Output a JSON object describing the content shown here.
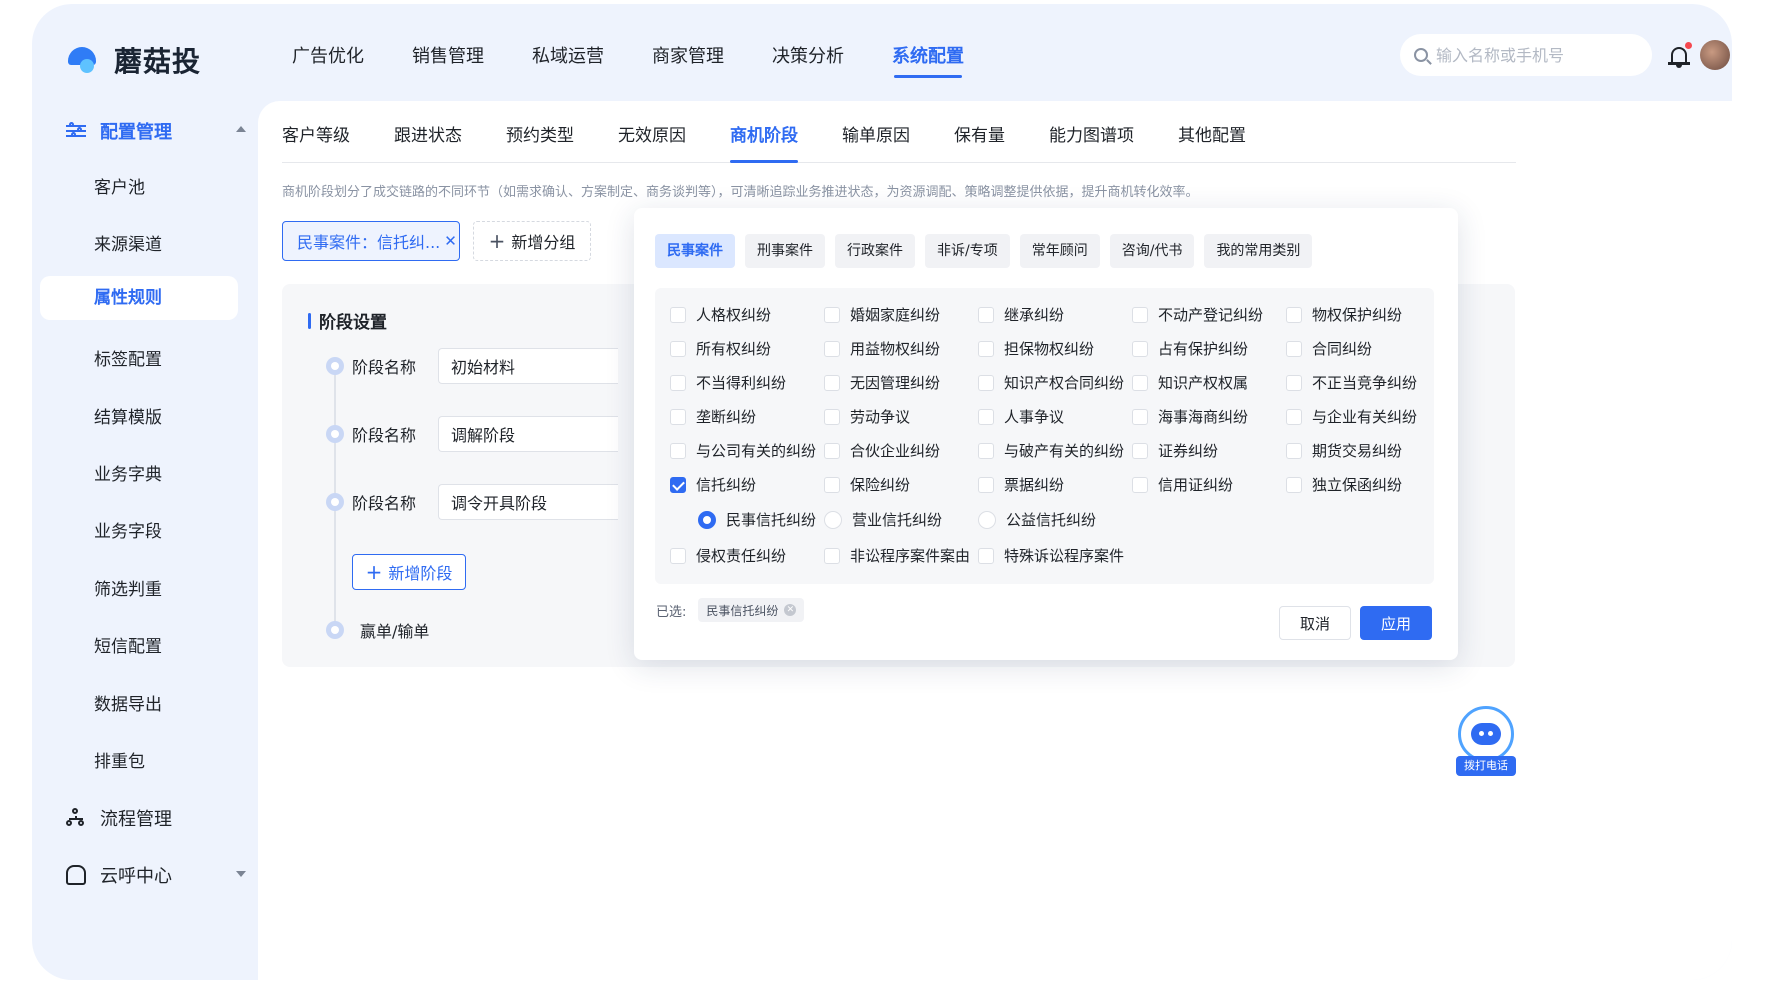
{
  "app": {
    "name": "蘑菇投"
  },
  "nav": {
    "items": [
      "广告优化",
      "销售管理",
      "私域运营",
      "商家管理",
      "决策分析",
      "系统配置"
    ],
    "active_index": 5
  },
  "search": {
    "placeholder": "输入名称或手机号",
    "value": ""
  },
  "sidebar": {
    "group_config": "配置管理",
    "items": [
      "客户池",
      "来源渠道",
      "属性规则",
      "标签配置",
      "结算模版",
      "业务字典",
      "业务字段",
      "筛选判重",
      "短信配置",
      "数据导出",
      "排重包"
    ],
    "active_index": 2,
    "group_flow": "流程管理",
    "group_call": "云呼中心"
  },
  "tabs": {
    "items": [
      "客户等级",
      "跟进状态",
      "预约类型",
      "无效原因",
      "商机阶段",
      "输单原因",
      "保有量",
      "能力图谱项",
      "其他配置"
    ],
    "active_index": 4
  },
  "description": "商机阶段划分了成交链路的不同环节（如需求确认、方案制定、商务谈判等），可清晰追踪业务推进状态，为资源调配、策略调整提供依据，提升商机转化效率。",
  "groups": {
    "active_chip": "民事案件：信托纠...",
    "add_label": "新增分组"
  },
  "stages": {
    "title": "阶段设置",
    "name_label": "阶段名称",
    "items": [
      "初始材料",
      "调解阶段",
      "调令开具阶段"
    ],
    "add_label": "新增阶段",
    "final_label": "赢单/输单"
  },
  "popover": {
    "tabs": [
      "民事案件",
      "刑事案件",
      "行政案件",
      "非诉/专项",
      "常年顾问",
      "咨询/代书",
      "我的常用类别"
    ],
    "active_tab": 0,
    "rows": [
      [
        "人格权纠纷",
        "婚姻家庭纠纷",
        "继承纠纷",
        "不动产登记纠纷",
        "物权保护纠纷"
      ],
      [
        "所有权纠纷",
        "用益物权纠纷",
        "担保物权纠纷",
        "占有保护纠纷",
        "合同纠纷"
      ],
      [
        "不当得利纠纷",
        "无因管理纠纷",
        "知识产权合同纠纷",
        "知识产权权属",
        "不正当竞争纠纷"
      ],
      [
        "垄断纠纷",
        "劳动争议",
        "人事争议",
        "海事海商纠纷",
        "与企业有关纠纷"
      ],
      [
        "与公司有关的纠纷",
        "合伙企业纠纷",
        "与破产有关的纠纷",
        "证券纠纷",
        "期货交易纠纷"
      ],
      [
        "信托纠纷",
        "保险纠纷",
        "票据纠纷",
        "信用证纠纷",
        "独立保函纠纷"
      ]
    ],
    "checked": "信托纠纷",
    "sub_options": [
      "民事信托纠纷",
      "营业信托纠纷",
      "公益信托纠纷"
    ],
    "sub_selected": "民事信托纠纷",
    "last_row": [
      "侵权责任纠纷",
      "非讼程序案件案由",
      "特殊诉讼程序案件"
    ],
    "selected_label": "已选:",
    "selected_items": [
      "民事信托纠纷"
    ],
    "cancel_label": "取消",
    "apply_label": "应用"
  },
  "float_call": {
    "label": "拨打电话"
  },
  "colors": {
    "accent": "#2f6bf2",
    "background": "#eef3fd"
  }
}
